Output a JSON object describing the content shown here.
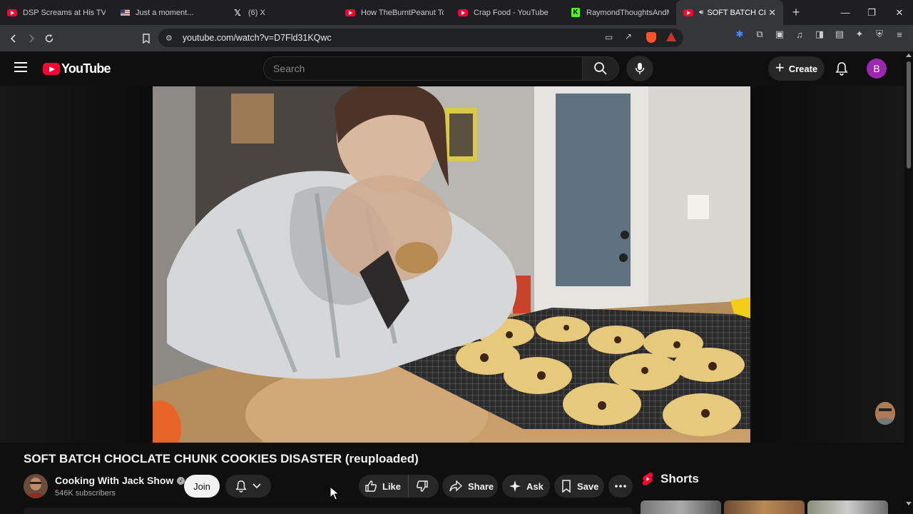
{
  "browser": {
    "tabs": [
      {
        "title": "DSP Screams at His TV as",
        "favicon": "youtube-icon"
      },
      {
        "title": "Just a moment...",
        "favicon": "us-flag-icon"
      },
      {
        "title": "(6) X",
        "favicon": "x-icon"
      },
      {
        "title": "How TheBurntPeanut Took",
        "favicon": "youtube-icon"
      },
      {
        "title": "Crap Food - YouTube",
        "favicon": "youtube-icon"
      },
      {
        "title": "RaymondThoughtsAndMi",
        "favicon": "kick-icon"
      },
      {
        "title": "SOFT BATCH CHOC",
        "favicon": "youtube-icon",
        "active": true
      }
    ],
    "url": "youtube.com/watch?v=D7Fld31KQwc"
  },
  "masthead": {
    "logo_text": "YouTube",
    "search_placeholder": "Search",
    "create_label": "Create",
    "account_initial": "B"
  },
  "video": {
    "title": "SOFT BATCH CHOCLATE CHUNK COOKIES DISASTER (reuploaded)"
  },
  "channel": {
    "name": "Cooking With Jack Show",
    "subscribers": "546K subscribers",
    "join_label": "Join"
  },
  "actions": {
    "like_label": "Like",
    "share_label": "Share",
    "ask_label": "Ask",
    "save_label": "Save"
  },
  "sidebar": {
    "shorts_label": "Shorts"
  },
  "colors": {
    "youtube_red": "#ff0033",
    "background": "#0f0f0f",
    "pill_bg": "#272727",
    "avatar_purple": "#9c27b0"
  }
}
